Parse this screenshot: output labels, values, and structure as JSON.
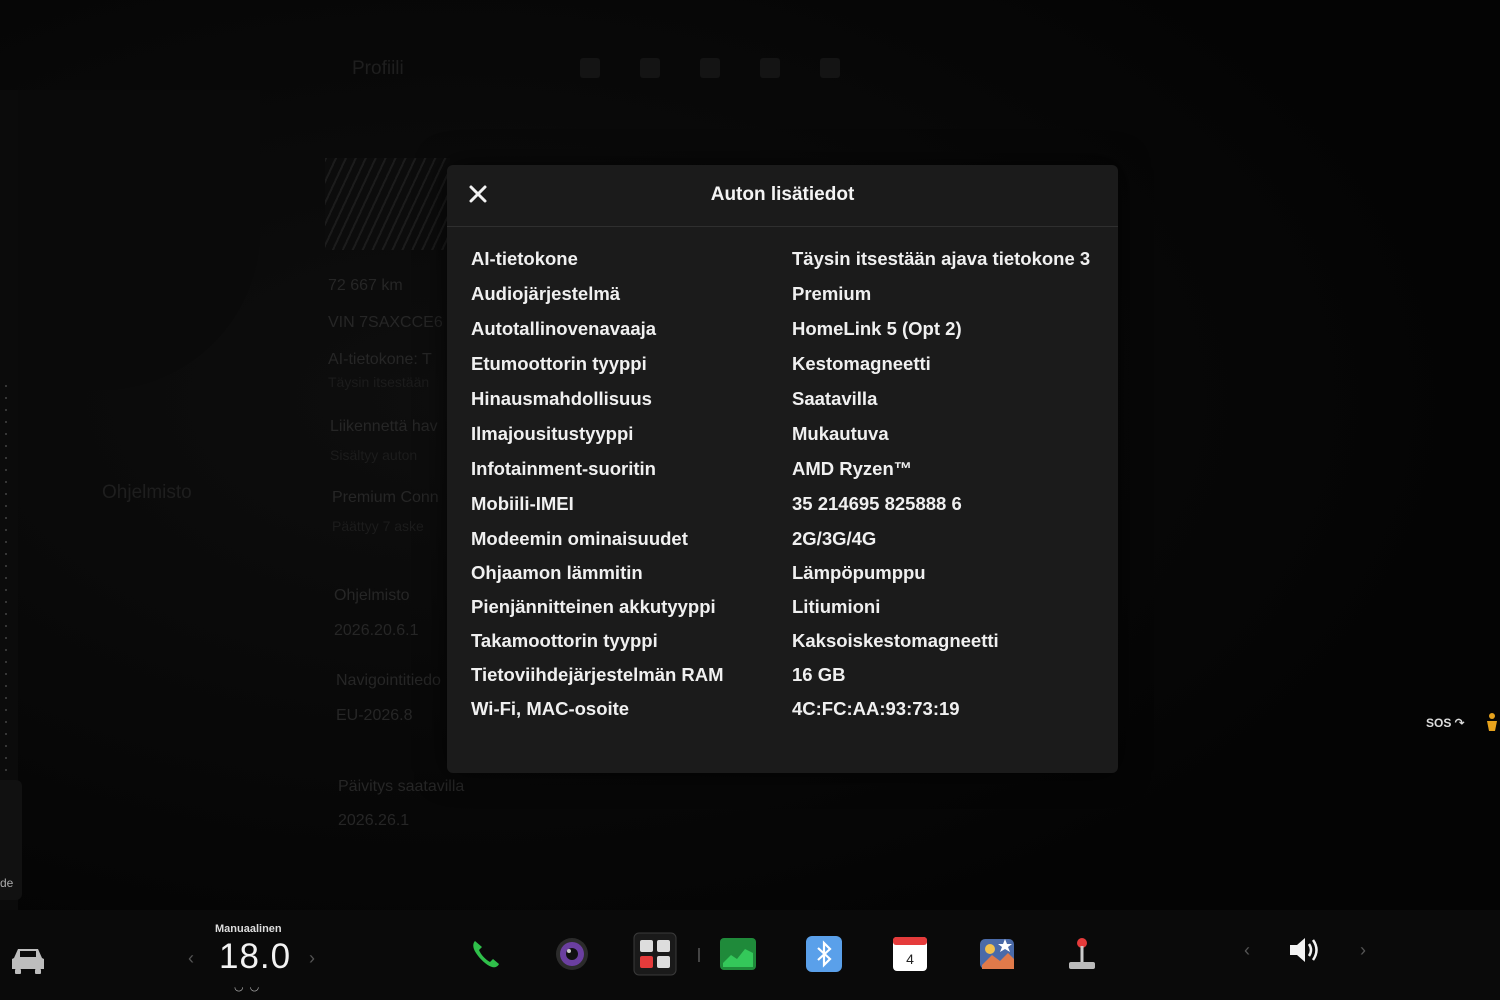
{
  "background": {
    "profile_label": "Profiili",
    "odometer": "72 667 km",
    "vin": "VIN 7SAXCCE6",
    "ai_label": "AI-tietokone: T",
    "ai_sub": "Täysin itsestään",
    "traffic_label": "Liikennettä hav",
    "traffic_sub": "Sisältyy auton",
    "software_nav": "Ohjelmisto",
    "premium_label": "Premium Conn",
    "premium_sub": "Päättyy 7 aske",
    "software_label": "Ohjelmisto",
    "software_version": "2026.20.6.1",
    "nav_label": "Navigointitiedo",
    "nav_version": "EU-2026.8",
    "update_label": "Päivitys saatavilla",
    "update_version": "2026.26.1",
    "side_tab_label": "de"
  },
  "modal": {
    "title": "Auton lisätiedot",
    "rows": [
      {
        "label": "AI-tietokone",
        "value": "Täysin itsestään ajava tietokone 3"
      },
      {
        "label": "Audiojärjestelmä",
        "value": "Premium"
      },
      {
        "label": "Autotallinovenavaaja",
        "value": "HomeLink 5 (Opt 2)"
      },
      {
        "label": "Etumoottorin tyyppi",
        "value": "Kestomagneetti"
      },
      {
        "label": "Hinausmahdollisuus",
        "value": "Saatavilla"
      },
      {
        "label": "Ilmajousitustyyppi",
        "value": "Mukautuva"
      },
      {
        "label": "Infotainment-suoritin",
        "value": "AMD Ryzen™"
      },
      {
        "label": "Mobiili-IMEI",
        "value": "35 214695 825888 6"
      },
      {
        "label": "Modeemin ominaisuudet",
        "value": "2G/3G/4G"
      },
      {
        "label": "Ohjaamon lämmitin",
        "value": "Lämpöpumppu"
      },
      {
        "label": "Pienjännitteinen akkutyyppi",
        "value": "Litiumioni"
      },
      {
        "label": "Takamoottorin tyyppi",
        "value": "Kaksoiskestomagneetti"
      },
      {
        "label": "Tietoviihdejärjestelmän RAM",
        "value": "16 GB"
      },
      {
        "label": "Wi-Fi, MAC-osoite",
        "value": "4C:FC:AA:93:73:19"
      }
    ]
  },
  "status": {
    "sos": "SOS"
  },
  "dock": {
    "climate_mode": "Manuaalinen",
    "temperature": "18.0",
    "calendar_day": "4"
  },
  "colors": {
    "modal_bg": "#1b1b1b",
    "phone": "#2fbf4a",
    "bluetooth": "#5aa0ea",
    "calendar_top": "#e53b3b"
  }
}
